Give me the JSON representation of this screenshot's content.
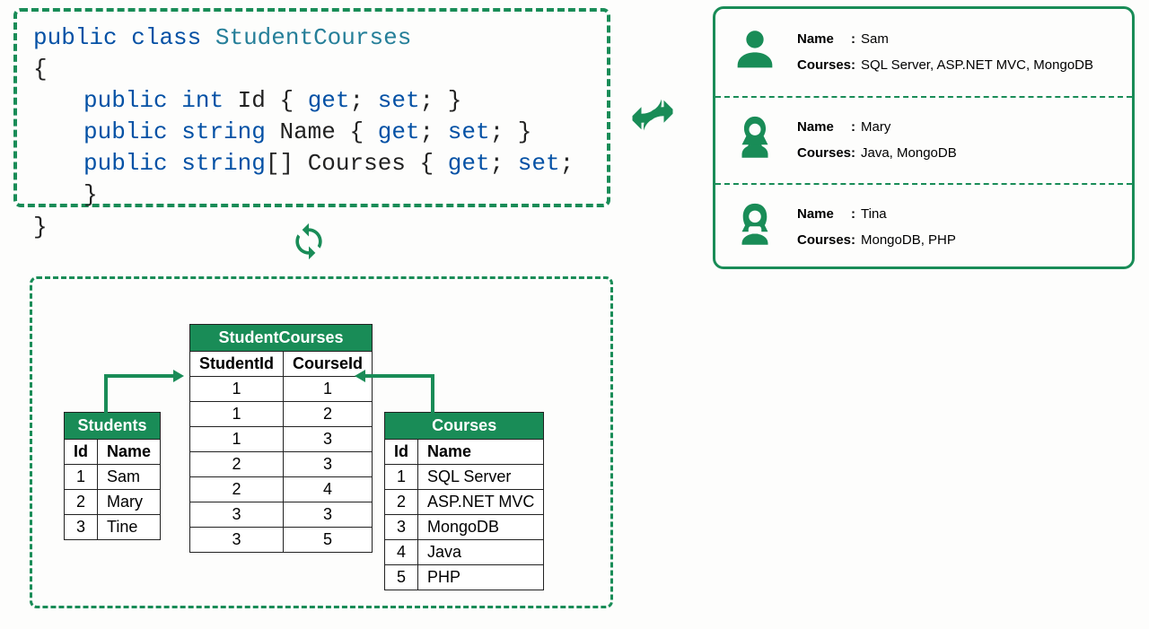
{
  "code": {
    "line1": {
      "public": "public",
      "class": "class",
      "classname": "StudentCourses"
    },
    "lbrace": "{",
    "line2": {
      "public": "public",
      "type": "int",
      "name": "Id",
      "get": "get",
      "set": "set"
    },
    "line3": {
      "public": "public",
      "type": "string",
      "name": "Name",
      "get": "get",
      "set": "set"
    },
    "line4": {
      "public": "public",
      "type": "string",
      "brackets": "[]",
      "name": "Courses",
      "get": "get",
      "set": "set"
    },
    "rbrace": "}"
  },
  "people": [
    {
      "name": "Sam",
      "courses": "SQL Server, ASP.NET MVC, MongoDB",
      "icon": "male"
    },
    {
      "name": "Mary",
      "courses": "Java, MongoDB",
      "icon": "female1"
    },
    {
      "name": "Tina",
      "courses": "MongoDB, PHP",
      "icon": "female2"
    }
  ],
  "labels": {
    "name": "Name",
    "courses": "Courses"
  },
  "tables": {
    "students": {
      "title": "Students",
      "headers": [
        "Id",
        "Name"
      ],
      "rows": [
        [
          "1",
          "Sam"
        ],
        [
          "2",
          "Mary"
        ],
        [
          "3",
          "Tine"
        ]
      ]
    },
    "studentcourses": {
      "title": "StudentCourses",
      "headers": [
        "StudentId",
        "CourseId"
      ],
      "rows": [
        [
          "1",
          "1"
        ],
        [
          "1",
          "2"
        ],
        [
          "1",
          "3"
        ],
        [
          "2",
          "3"
        ],
        [
          "2",
          "4"
        ],
        [
          "3",
          "3"
        ],
        [
          "3",
          "5"
        ]
      ]
    },
    "courses": {
      "title": "Courses",
      "headers": [
        "Id",
        "Name"
      ],
      "rows": [
        [
          "1",
          "SQL Server"
        ],
        [
          "2",
          "ASP.NET MVC"
        ],
        [
          "3",
          "MongoDB"
        ],
        [
          "4",
          "Java"
        ],
        [
          "5",
          "PHP"
        ]
      ]
    }
  },
  "chart_data": {
    "type": "table",
    "title": "Object-Relational and Object-Document mapping for StudentCourses class",
    "class_definition": {
      "name": "StudentCourses",
      "properties": [
        {
          "name": "Id",
          "type": "int"
        },
        {
          "name": "Name",
          "type": "string"
        },
        {
          "name": "Courses",
          "type": "string[]"
        }
      ]
    },
    "documents": [
      {
        "Name": "Sam",
        "Courses": [
          "SQL Server",
          "ASP.NET MVC",
          "MongoDB"
        ]
      },
      {
        "Name": "Mary",
        "Courses": [
          "Java",
          "MongoDB"
        ]
      },
      {
        "Name": "Tina",
        "Courses": [
          "MongoDB",
          "PHP"
        ]
      }
    ],
    "relational_tables": {
      "Students": {
        "columns": [
          "Id",
          "Name"
        ],
        "rows": [
          [
            1,
            "Sam"
          ],
          [
            2,
            "Mary"
          ],
          [
            3,
            "Tine"
          ]
        ]
      },
      "StudentCourses": {
        "columns": [
          "StudentId",
          "CourseId"
        ],
        "rows": [
          [
            1,
            1
          ],
          [
            1,
            2
          ],
          [
            1,
            3
          ],
          [
            2,
            3
          ],
          [
            2,
            4
          ],
          [
            3,
            3
          ],
          [
            3,
            5
          ]
        ]
      },
      "Courses": {
        "columns": [
          "Id",
          "Name"
        ],
        "rows": [
          [
            1,
            "SQL Server"
          ],
          [
            2,
            "ASP.NET MVC"
          ],
          [
            3,
            "MongoDB"
          ],
          [
            4,
            "Java"
          ],
          [
            5,
            "PHP"
          ]
        ]
      }
    }
  },
  "colors": {
    "accent": "#198c57"
  }
}
